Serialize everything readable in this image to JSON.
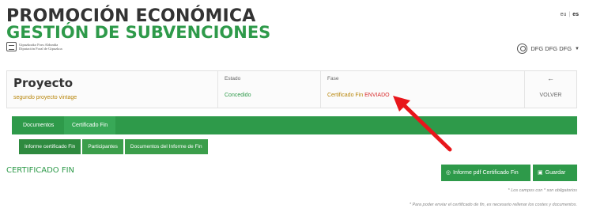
{
  "header": {
    "title_line1": "PROMOCIÓN ECONÓMICA",
    "title_line2": "GESTIÓN DE SUBVENCIONES",
    "org_line1": "Gipuzkoako Foru Aldundia",
    "org_line2": "Diputación Foral de Gipuzkoa",
    "lang_eu": "eu",
    "lang_es": "es",
    "user_name": "DFG DFG DFG"
  },
  "proyecto": {
    "title": "Proyecto",
    "subtitle": "segundo proyecto vintage",
    "estado_label": "Estado",
    "estado_value": "Concedido",
    "fase_label": "Fase",
    "fase_value": "Certificado Fin",
    "fase_status": "ENVIADO",
    "back_icon": "←",
    "back_label": "VOLVER"
  },
  "tabs": [
    {
      "label": "Documentos"
    },
    {
      "label": "Certificado Fin"
    }
  ],
  "subtabs": [
    {
      "label": "Informe certificado Fin"
    },
    {
      "label": "Participantes"
    },
    {
      "label": "Documentos del Informe de Fin"
    }
  ],
  "section": {
    "title": "CERTIFICADO FIN",
    "pdf_button": "Informe pdf Certificado Fin",
    "save_button": "Guardar"
  },
  "notes": {
    "required": "* Los campos con * son obligatorios",
    "info": "* Para poder enviar el certificado de fin, es necesario rellenar los costes y documentos."
  },
  "colors": {
    "brand_green": "#2e9a4a",
    "annotation_arrow": "#e8161b",
    "status_red": "#d82c2c"
  },
  "icons": {
    "user": "user-circle-icon",
    "back": "arrow-left-icon",
    "pdf": "pdf-icon",
    "save": "save-icon",
    "logo": "coat-of-arms-icon"
  }
}
